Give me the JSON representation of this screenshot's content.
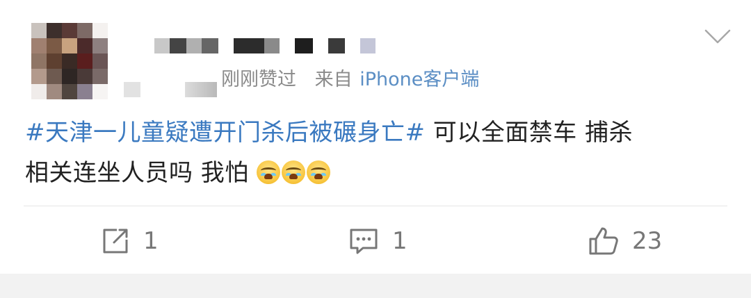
{
  "post": {
    "meta": {
      "time": "刚刚赞过",
      "from_label": "来自",
      "source": "iPhone客户端"
    },
    "topic": "#天津一儿童疑遭开门杀后被碾身亡#",
    "text_line1_rest": " 可以全面禁车 捕杀",
    "text_line2": "相关连坐人员吗 我怕",
    "emoji": [
      "crying-emoji",
      "crying-emoji",
      "crying-emoji"
    ]
  },
  "actions": {
    "repost_count": "1",
    "comment_count": "1",
    "like_count": "23"
  },
  "colors": {
    "topic": "#3a79c0",
    "source": "#5b8ec4",
    "meta": "#8a8a8a",
    "text": "#222222",
    "icon": "#777777"
  }
}
